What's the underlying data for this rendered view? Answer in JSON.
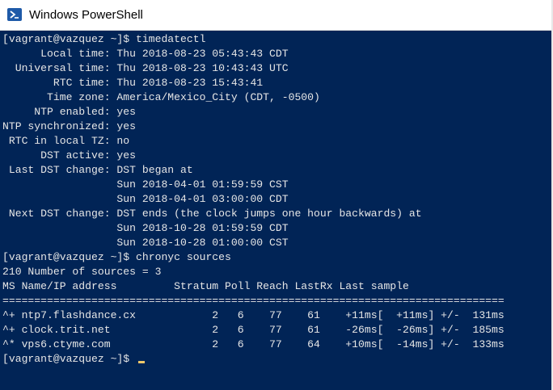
{
  "window": {
    "title": "Windows PowerShell",
    "icon": "powershell-icon",
    "colors": {
      "background": "#012456",
      "text": "#e6e6e6",
      "cursor": "#eec86a"
    }
  },
  "terminal": {
    "lines": [
      "[vagrant@vazquez ~]$ timedatectl",
      "      Local time: Thu 2018-08-23 05:43:43 CDT",
      "  Universal time: Thu 2018-08-23 10:43:43 UTC",
      "        RTC time: Thu 2018-08-23 15:43:41",
      "       Time zone: America/Mexico_City (CDT, -0500)",
      "     NTP enabled: yes",
      "NTP synchronized: yes",
      " RTC in local TZ: no",
      "      DST active: yes",
      " Last DST change: DST began at",
      "                  Sun 2018-04-01 01:59:59 CST",
      "                  Sun 2018-04-01 03:00:00 CDT",
      " Next DST change: DST ends (the clock jumps one hour backwards) at",
      "                  Sun 2018-10-28 01:59:59 CDT",
      "                  Sun 2018-10-28 01:00:00 CST",
      "[vagrant@vazquez ~]$ chronyc sources",
      "210 Number of sources = 3",
      "MS Name/IP address         Stratum Poll Reach LastRx Last sample",
      "===============================================================================",
      "^+ ntp7.flashdance.cx            2   6    77    61    +11ms[  +11ms] +/-  131ms",
      "^+ clock.trit.net                2   6    77    61    -26ms[  -26ms] +/-  185ms",
      "^* vps6.ctyme.com                2   6    77    64    +10ms[  -14ms] +/-  133ms",
      "[vagrant@vazquez ~]$ "
    ]
  }
}
